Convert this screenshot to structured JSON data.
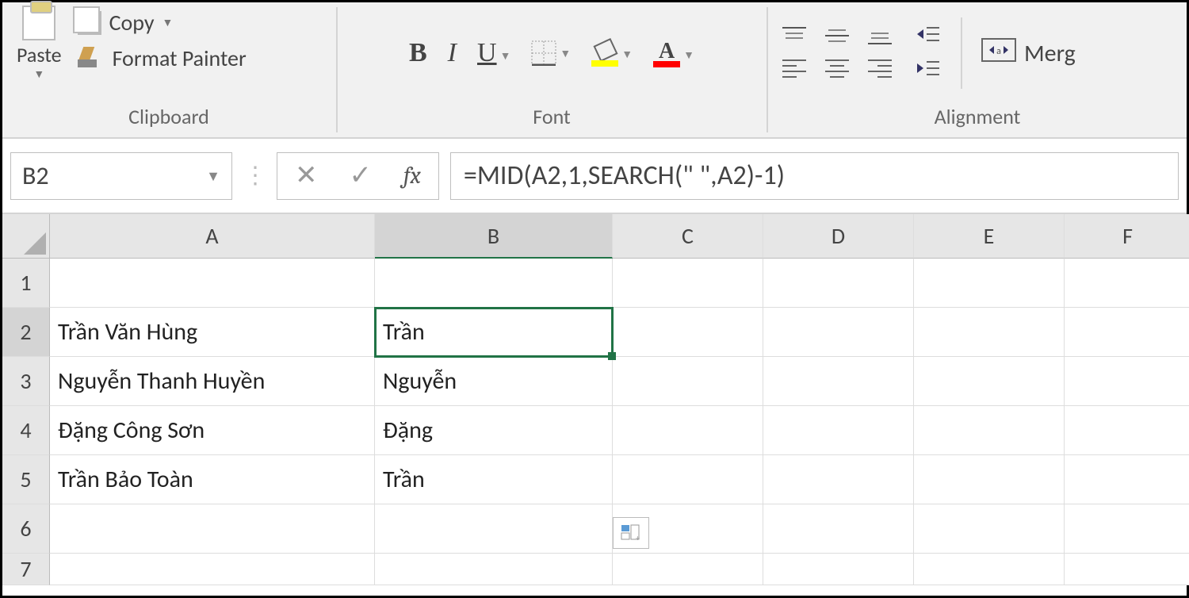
{
  "ribbon": {
    "clipboard": {
      "paste_label": "Paste",
      "copy_label": "Copy",
      "format_painter_label": "Format Painter",
      "group_label": "Clipboard"
    },
    "font": {
      "bold": "B",
      "italic": "I",
      "underline": "U",
      "group_label": "Font",
      "font_color_letter": "A"
    },
    "alignment": {
      "group_label": "Alignment",
      "merge_label": "Merg"
    }
  },
  "formula_bar": {
    "name_box": "B2",
    "fx_label": "fx",
    "formula": "=MID(A2,1,SEARCH(\" \",A2)-1)"
  },
  "columns": [
    "A",
    "B",
    "C",
    "D",
    "E",
    "F"
  ],
  "rows": [
    "1",
    "2",
    "3",
    "4",
    "5",
    "6",
    "7"
  ],
  "selected_cell": "B2",
  "cells": {
    "A2": "Trần Văn Hùng",
    "A3": "Nguyễn Thanh Huyền",
    "A4": "Đặng Công Sơn",
    "A5": "Trần Bảo Toàn",
    "B2": "Trần",
    "B3": "Nguyễn",
    "B4": "Đặng",
    "B5": "Trần"
  }
}
